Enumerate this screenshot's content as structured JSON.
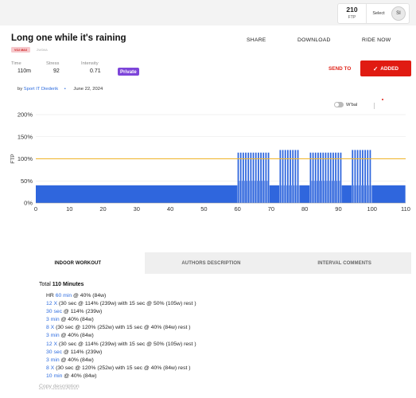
{
  "topbar": {
    "ftp_value": "210",
    "ftp_label": "FTP",
    "select_label": "Select",
    "avatar_initials": "SI"
  },
  "workout": {
    "title": "Long one while it's raining",
    "tag": "VO2 MAX",
    "tag2": "ZWOMA",
    "stats": [
      {
        "label": "Time",
        "value": "110m"
      },
      {
        "label": "Stress",
        "value": "92"
      },
      {
        "label": "Intensity",
        "value": "0.71"
      }
    ],
    "privacy": "Private",
    "by_prefix": "by",
    "author": "Sport IT Diederik",
    "separator": "•",
    "date": "June 22, 2024"
  },
  "actions": {
    "share": "SHARE",
    "download": "DOWNLOAD",
    "ride_now": "RIDE NOW",
    "send_to": "SEND TO",
    "added": "ADDED"
  },
  "wbal_label": "W'bal",
  "colors": {
    "accent": "#e01b12",
    "bar": "#2f66dd",
    "ftp_line": "#f0b429",
    "private": "#7d45d9",
    "link": "#2d6cdf"
  },
  "chart_data": {
    "type": "bar",
    "ylabel": "FTP",
    "yticks": [
      "0%",
      "50%",
      "100%",
      "150%",
      "200%"
    ],
    "xticks": [
      "0",
      "10",
      "20",
      "30",
      "40",
      "50",
      "60",
      "70",
      "80",
      "90",
      "100",
      "110"
    ],
    "ylim": [
      0,
      200
    ],
    "xlim": [
      0,
      110
    ],
    "ftp_line": 100,
    "segments": [
      {
        "start": 0,
        "duration": 60,
        "power": 40
      },
      {
        "block": "interval",
        "start": 60,
        "reps": 12,
        "on_duration": 0.5,
        "on_power": 114,
        "off_duration": 0.25,
        "off_power": 50
      },
      {
        "start": 69,
        "duration": 0.5,
        "power": 114
      },
      {
        "start": 69.5,
        "duration": 3,
        "power": 40
      },
      {
        "block": "interval",
        "start": 72.5,
        "reps": 8,
        "on_duration": 0.5,
        "on_power": 120,
        "off_duration": 0.25,
        "off_power": 40
      },
      {
        "start": 78.5,
        "duration": 3,
        "power": 40
      },
      {
        "block": "interval",
        "start": 81.5,
        "reps": 12,
        "on_duration": 0.5,
        "on_power": 114,
        "off_duration": 0.25,
        "off_power": 50
      },
      {
        "start": 90.5,
        "duration": 0.5,
        "power": 114
      },
      {
        "start": 91,
        "duration": 3,
        "power": 40
      },
      {
        "block": "interval",
        "start": 94,
        "reps": 8,
        "on_duration": 0.5,
        "on_power": 120,
        "off_duration": 0.25,
        "off_power": 40
      },
      {
        "start": 100,
        "duration": 10,
        "power": 40
      }
    ]
  },
  "tabs": [
    "INDOOR WORKOUT",
    "AUTHORS DESCRIPTION",
    "INTERVAL COMMENTS"
  ],
  "description": {
    "total_prefix": "Total",
    "total_value": "110 Minutes",
    "lines": [
      {
        "pre": "HR ",
        "link": "60 min",
        "post": " @ 40% (84w)"
      },
      {
        "pre": "",
        "link": "12 X",
        "post": " (30 sec @ 114% (239w) with 15 sec @ 50% (105w) rest )"
      },
      {
        "pre": "",
        "link": "30 sec",
        "post": " @ 114% (239w)"
      },
      {
        "pre": "",
        "link": "3 min",
        "post": " @ 40% (84w)"
      },
      {
        "pre": "",
        "link": "8 X",
        "post": " (30 sec @ 120% (252w) with 15 sec @ 40% (84w) rest )"
      },
      {
        "pre": "",
        "link": "3 min",
        "post": " @ 40% (84w)"
      },
      {
        "pre": "",
        "link": "12 X",
        "post": " (30 sec @ 114% (239w) with 15 sec @ 50% (105w) rest )"
      },
      {
        "pre": "",
        "link": "30 sec",
        "post": " @ 114% (239w)"
      },
      {
        "pre": "",
        "link": "3 min",
        "post": " @ 40% (84w)"
      },
      {
        "pre": "",
        "link": "8 X",
        "post": " (30 sec @ 120% (252w) with 15 sec @ 40% (84w) rest )"
      },
      {
        "pre": "",
        "link": "10 min",
        "post": " @ 40% (84w)"
      }
    ],
    "copy": "Copy description"
  }
}
